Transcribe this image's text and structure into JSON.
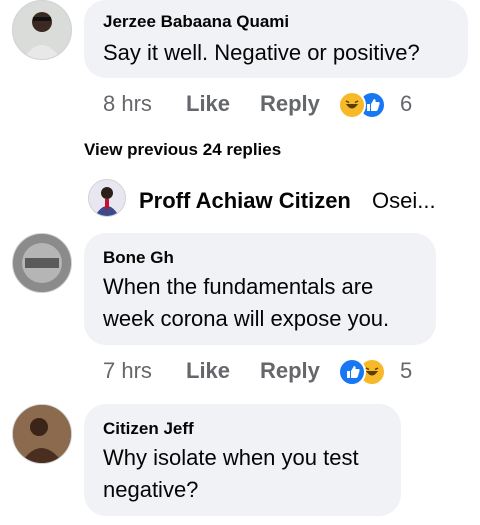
{
  "comments": [
    {
      "author": "Jerzee Babaana Quami",
      "text": "Say it well. Negative or positive?",
      "time": "8 hrs",
      "like_label": "Like",
      "reply_label": "Reply",
      "reactions": [
        "haha",
        "like"
      ],
      "reaction_count": "6"
    },
    {
      "author": "Bone Gh",
      "text_lines": [
        "When the fundamentals are",
        "week corona will expose you."
      ],
      "time": "7 hrs",
      "like_label": "Like",
      "reply_label": "Reply",
      "reactions": [
        "like",
        "haha"
      ],
      "reaction_count": "5"
    },
    {
      "author": "Citizen Jeff",
      "text_lines": [
        "Why isolate when you test",
        "negative?"
      ]
    }
  ],
  "view_previous": "View previous 24 replies",
  "reply_preview": {
    "author": "Proff Achiaw Citizen",
    "snippet": "Osei..."
  },
  "colors": {
    "bubble": "#f0f2f5",
    "meta_text": "#65676b",
    "like_blue": "#1877f2",
    "haha_yellow": "#f7b928"
  }
}
